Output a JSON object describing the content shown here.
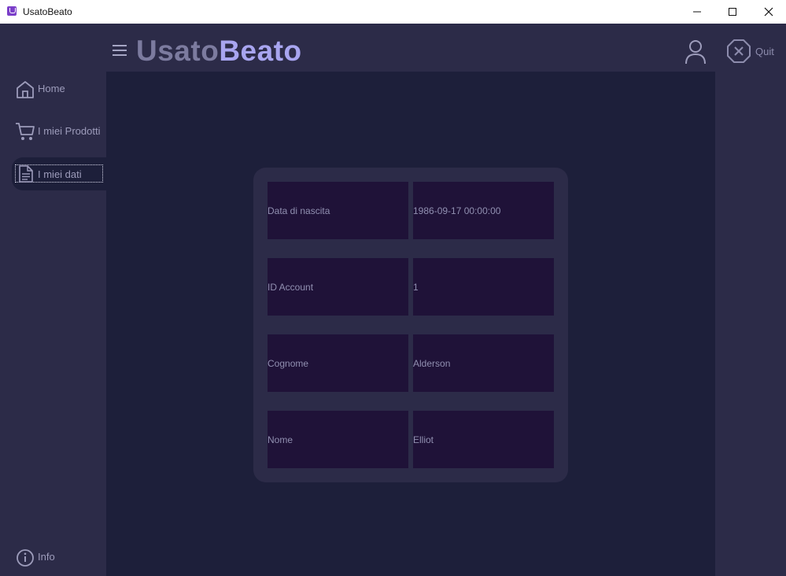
{
  "window": {
    "title": "UsatoBeato",
    "controls": {
      "minimize": "minimize",
      "maximize": "maximize",
      "close": "close"
    }
  },
  "header": {
    "logo_part1": "Usato",
    "logo_part2": "Beato",
    "quit_label": "Quit"
  },
  "sidebar": {
    "items": [
      {
        "label": "Home",
        "icon": "home-icon"
      },
      {
        "label": "I miei Prodotti",
        "icon": "cart-icon"
      },
      {
        "label": "I miei dati",
        "icon": "document-icon",
        "selected": true
      },
      {
        "label": "Info",
        "icon": "info-icon"
      }
    ]
  },
  "details": {
    "rows": [
      {
        "label": "Data di nascita",
        "value": "1986-09-17 00:00:00"
      },
      {
        "label": "ID Account",
        "value": "1"
      },
      {
        "label": "Cognome",
        "value": "Alderson"
      },
      {
        "label": "Nome",
        "value": "Elliot"
      }
    ]
  },
  "colors": {
    "background": "#2c2b48",
    "content": "#1d1f3a",
    "cell": "#1f1238",
    "accent": "#a8a5f0",
    "text": "#9d9cbb"
  }
}
